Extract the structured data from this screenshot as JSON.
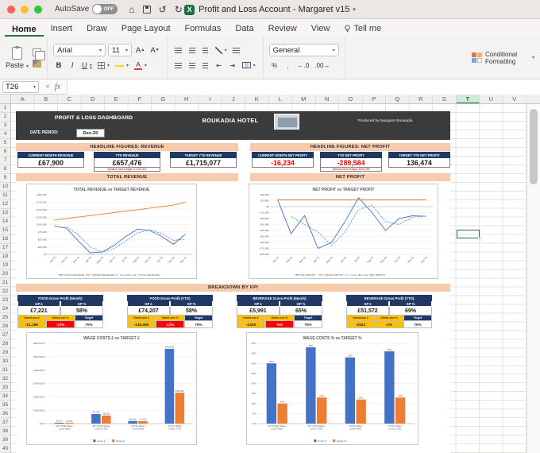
{
  "titlebar": {
    "autosave_label": "AutoSave",
    "autosave_state": "OFF",
    "title": "Profit and Loss Account - Margaret v15"
  },
  "ribbon": {
    "tabs": [
      {
        "label": "Home",
        "active": true
      },
      {
        "label": "Insert"
      },
      {
        "label": "Draw"
      },
      {
        "label": "Page Layout"
      },
      {
        "label": "Formulas"
      },
      {
        "label": "Data"
      },
      {
        "label": "Review"
      },
      {
        "label": "View"
      },
      {
        "label": "Tell me",
        "icon": "lightbulb"
      }
    ],
    "paste_label": "Paste",
    "font_name": "Arial",
    "font_size": "11",
    "bold_label": "B",
    "italic_label": "I",
    "underline_label": "U",
    "number_format": "General",
    "percent_label": "%",
    "comma_label": ",",
    "inc_decimal_label": "←.0",
    "dec_decimal_label": ".00→",
    "conditional_formatting_label": "Conditional Formatting"
  },
  "formula_bar": {
    "name_box": "T26",
    "cancel_label": "×",
    "fx_label": "fx"
  },
  "grid": {
    "columns": [
      "A",
      "B",
      "C",
      "D",
      "E",
      "F",
      "G",
      "H",
      "I",
      "J",
      "K",
      "L",
      "M",
      "N",
      "O",
      "P",
      "Q",
      "R",
      "S",
      "T",
      "U",
      "V"
    ],
    "row_count": 40,
    "selected_column": "T",
    "selected_cell": "T26"
  },
  "dashboard": {
    "title": "PROFIT & LOSS DASHBOARD",
    "hotel_name": "BOUKADIA HOTEL",
    "produced_by": "Produced by Margaret Boukadia",
    "date_period_label": "DATE PERIOD:",
    "date_period_value": "Dec-20",
    "revenue_banner": "HEADLINE FIGURES: REVENUE",
    "profit_banner": "HEADLINE FIGURES: NET PROFIT",
    "revenue_cards": [
      {
        "label": "CURRENT MONTH REVENUE",
        "value": "£67,900"
      },
      {
        "label": "YTD REVENUE",
        "value": "£657,476",
        "subtext": "Variance from budget -£1,057,601"
      },
      {
        "label": "TARGET YTD REVENUE",
        "value": "£1,715,077"
      }
    ],
    "profit_cards": [
      {
        "label": "CURRENT MONTH NET PROFIT",
        "value": "-16,234",
        "negative": true
      },
      {
        "label": "YTD NET PROFIT",
        "value": "-289,584",
        "negative": true,
        "subtext": "Variance from budget -£426,058"
      },
      {
        "label": "TARGET YTD NET PROFIT",
        "value": "136,474"
      }
    ],
    "total_revenue_banner": "TOTAL REVENUE",
    "net_profit_banner": "NET PROFIT",
    "kpi_banner": "BREAKDOWN BY KPI",
    "kpi_labels": {
      "gp_currency": "GP £",
      "gp_pct": "GP %",
      "gain_currency": "Gain/Loss £",
      "gain_pct": "Gain/Loss %",
      "target": "Target"
    },
    "kpi_cards": [
      {
        "title": "FOOD Gross Profit (Month)",
        "gp_currency": "£7,221",
        "gp_pct": "58%",
        "gain_currency": "-£1,165",
        "gain_currency_bg": "#ffc000",
        "gain_pct": "-12%",
        "gain_pct_bg": "#ff0000",
        "target": "70%"
      },
      {
        "title": "FOOD Gross Profit (YTD)",
        "gp_currency": "£74,207",
        "gp_pct": "58%",
        "gain_currency": "-£15,308",
        "gain_currency_bg": "#ffc000",
        "gain_pct": "-12%",
        "gain_pct_bg": "#ff0000",
        "target": "70%"
      },
      {
        "title": "BEVERAGE Gross Profit (Month)",
        "gp_currency": "£5,991",
        "gp_pct": "65%",
        "gain_currency": "-£428",
        "gain_currency_bg": "#ffc000",
        "gain_pct": "-5%",
        "gain_pct_bg": "#ff0000",
        "target": "70%"
      },
      {
        "title": "BEVERAGE Gross Profit (YTD)",
        "gp_currency": "£51,572",
        "gp_pct": "69%",
        "gain_currency": "-£513",
        "gain_currency_bg": "#ffc000",
        "gain_pct": "-1%",
        "gain_pct_bg": "#ffc000",
        "target": "70%"
      }
    ]
  },
  "chart_data": [
    {
      "id": "revenue_line",
      "type": "line",
      "title": "TOTAL REVENUE vs TARGET REVENUE",
      "x": [
        "Jan-20",
        "Feb-20",
        "Mar-20",
        "Apr-20",
        "May-20",
        "Jun-20",
        "Jul-20",
        "Aug-20",
        "Sep-20",
        "Oct-20",
        "Nov-20",
        "Dec-20"
      ],
      "series": [
        {
          "name": "TOTAL REVENUE",
          "color": "#4472c4",
          "values": [
            95000,
            88000,
            45000,
            5000,
            8000,
            30000,
            60000,
            85000,
            80000,
            60000,
            33576,
            67900
          ]
        },
        {
          "name": "TARGET REVENUE",
          "color": "#ed7d31",
          "values": [
            115000,
            120000,
            125000,
            130000,
            135000,
            140000,
            145000,
            150000,
            155000,
            160000,
            165000,
            175077
          ]
        },
        {
          "name": "2 per. Mov. Avg. (TOTAL REVENUE)",
          "color": "#5b9bd5",
          "dashed": true,
          "values": [
            null,
            91500,
            66500,
            25000,
            6500,
            19000,
            45000,
            72500,
            82500,
            70000,
            46788,
            50738
          ]
        }
      ],
      "ylim": [
        0,
        200000
      ],
      "ytick": 25000,
      "yfmt": "gbp",
      "grid": true,
      "legend_position": "bottom"
    },
    {
      "id": "profit_line",
      "type": "line",
      "title": "NET PROFIT vs TARGET PROFIT",
      "x": [
        "Jan-20",
        "Feb-20",
        "Mar-20",
        "Apr-20",
        "May-20",
        "Jun-20",
        "Jul-20",
        "Aug-20",
        "Sep-20",
        "Oct-20",
        "Nov-20",
        "Dec-20"
      ],
      "series": [
        {
          "name": "NET PROFIT",
          "color": "#4472c4",
          "values": [
            12000,
            -45000,
            -15000,
            -70000,
            -60000,
            -25000,
            15000,
            -10000,
            -40000,
            -20000,
            -15350,
            -16234
          ]
        },
        {
          "name": "TARGET PROFIT",
          "color": "#ed7d31",
          "values": [
            11373,
            11373,
            11373,
            11373,
            11373,
            11373,
            11373,
            11373,
            11373,
            11373,
            11373,
            11371
          ]
        },
        {
          "name": "2 per. Mov. Avg. (NET PROFIT)",
          "color": "#5b9bd5",
          "dashed": true,
          "values": [
            null,
            -16500,
            -30000,
            -42500,
            -65000,
            -42500,
            -5000,
            2500,
            -25000,
            -30000,
            -17675,
            -15792
          ]
        }
      ],
      "ylim": [
        -80000,
        20000
      ],
      "ytick": 10000,
      "yfmt": "gbp",
      "grid": true,
      "legend_position": "bottom"
    },
    {
      "id": "wage_gbp",
      "type": "bar",
      "title": "WAGE COSTS £ vs TARGET £",
      "categories": [
        "MT OVRH Wage Costs (Mth)",
        "MT OVRH Wage Costs (YTD)",
        "TOTAL Wage Costs (Mth)",
        "TOTAL Wage Costs (YTD)"
      ],
      "series": [
        {
          "name": "Costs £",
          "color": "#4472c4",
          "values": [
            6504,
            71653,
            19038,
            558868
          ],
          "labels": [
            "£6,504",
            "£71,653",
            "£19,038",
            "£558,868"
          ]
        },
        {
          "name": "Target £",
          "color": "#ed7d31",
          "values": [
            5500,
            60386,
            17820,
            230688
          ],
          "labels": [
            "£5,500",
            "£60,386",
            "£17,820",
            "£230,688"
          ]
        }
      ],
      "ylim": [
        0,
        600000
      ],
      "ytick": 100000,
      "yfmt": "gbp2",
      "grid": true,
      "legend_position": "bottom"
    },
    {
      "id": "wage_pct",
      "type": "bar",
      "title": "WAGE COSTS % vs TARGET %",
      "categories": [
        "MT OVRH Wage Costs (Mth)",
        "MT OVRH Wage Costs (YTD)",
        "TOTAL Wage Costs (Mth)",
        "TOTAL Wage Costs (YTD)"
      ],
      "series": [
        {
          "name": "Costs %",
          "color": "#4472c4",
          "values": [
            30,
            38,
            33,
            36
          ],
          "labels": [
            "30%",
            "38%",
            "33%",
            "36%"
          ]
        },
        {
          "name": "Target %",
          "color": "#ed7d31",
          "values": [
            10,
            13,
            12,
            13
          ],
          "labels": [
            "10%",
            "13%",
            "12%",
            "13%"
          ]
        }
      ],
      "ylim": [
        0,
        40
      ],
      "ytick": 5,
      "yfmt": "pct",
      "grid": true,
      "legend_position": "bottom"
    }
  ]
}
